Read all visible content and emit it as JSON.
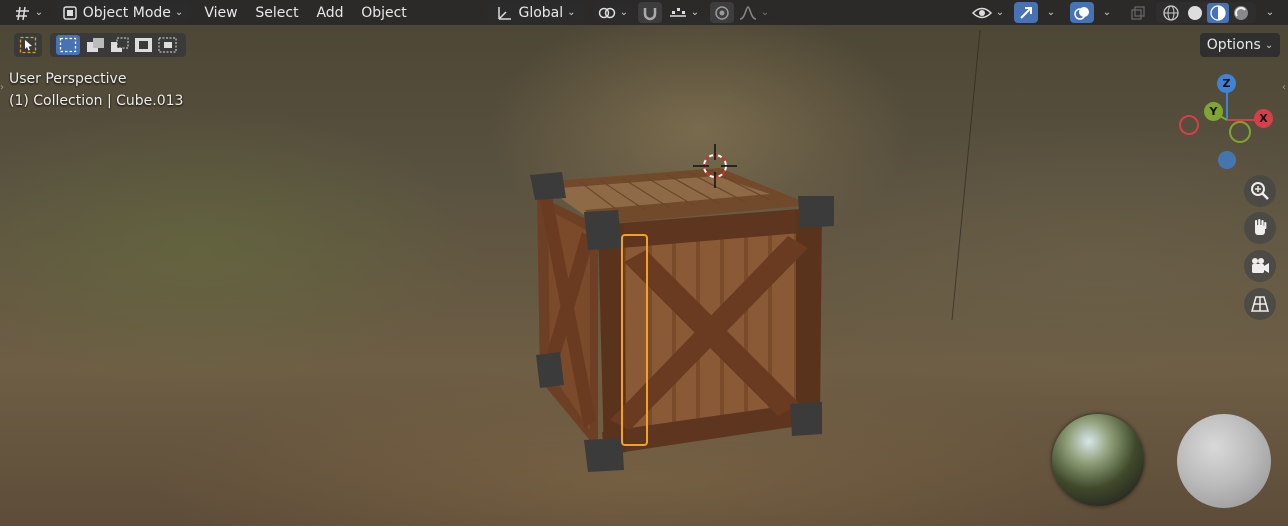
{
  "header": {
    "editor_type_icon": "gizmo-tripod-icon",
    "mode_label": "Object Mode",
    "menus": [
      "View",
      "Select",
      "Add",
      "Object"
    ],
    "transform_orientation": "Global",
    "colors": {
      "header_bg": "#282828",
      "active_blue": "#4772b3",
      "gizmo_x": "#d33f4a",
      "gizmo_y": "#7fa632",
      "gizmo_z": "#3f82d6"
    }
  },
  "tool_header": {
    "select_tool_icon": "select-box-icon"
  },
  "viewport": {
    "view_name": "User Perspective",
    "collection_line": "(1) Collection | Cube.013",
    "options_label": "Options"
  },
  "gizmo": {
    "x_label": "X",
    "y_label": "Y",
    "z_label": "Z"
  }
}
